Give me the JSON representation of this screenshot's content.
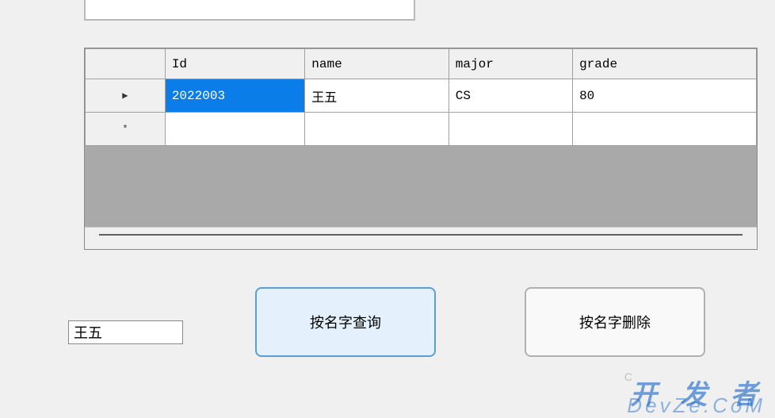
{
  "grid": {
    "columns": [
      "Id",
      "name",
      "major",
      "grade"
    ],
    "rows": [
      {
        "indicator": "▶",
        "id": "2022003",
        "name": "王五",
        "major": "CS",
        "grade": "80",
        "selected_col": "id"
      },
      {
        "indicator": "*",
        "id": "",
        "name": "",
        "major": "",
        "grade": ""
      }
    ]
  },
  "input": {
    "name_value": "王五"
  },
  "buttons": {
    "query_label": "按名字查询",
    "delete_label": "按名字删除"
  },
  "watermark": {
    "line1": "开 发 者",
    "line2": "DevZe.CoM",
    "faint": "C"
  }
}
